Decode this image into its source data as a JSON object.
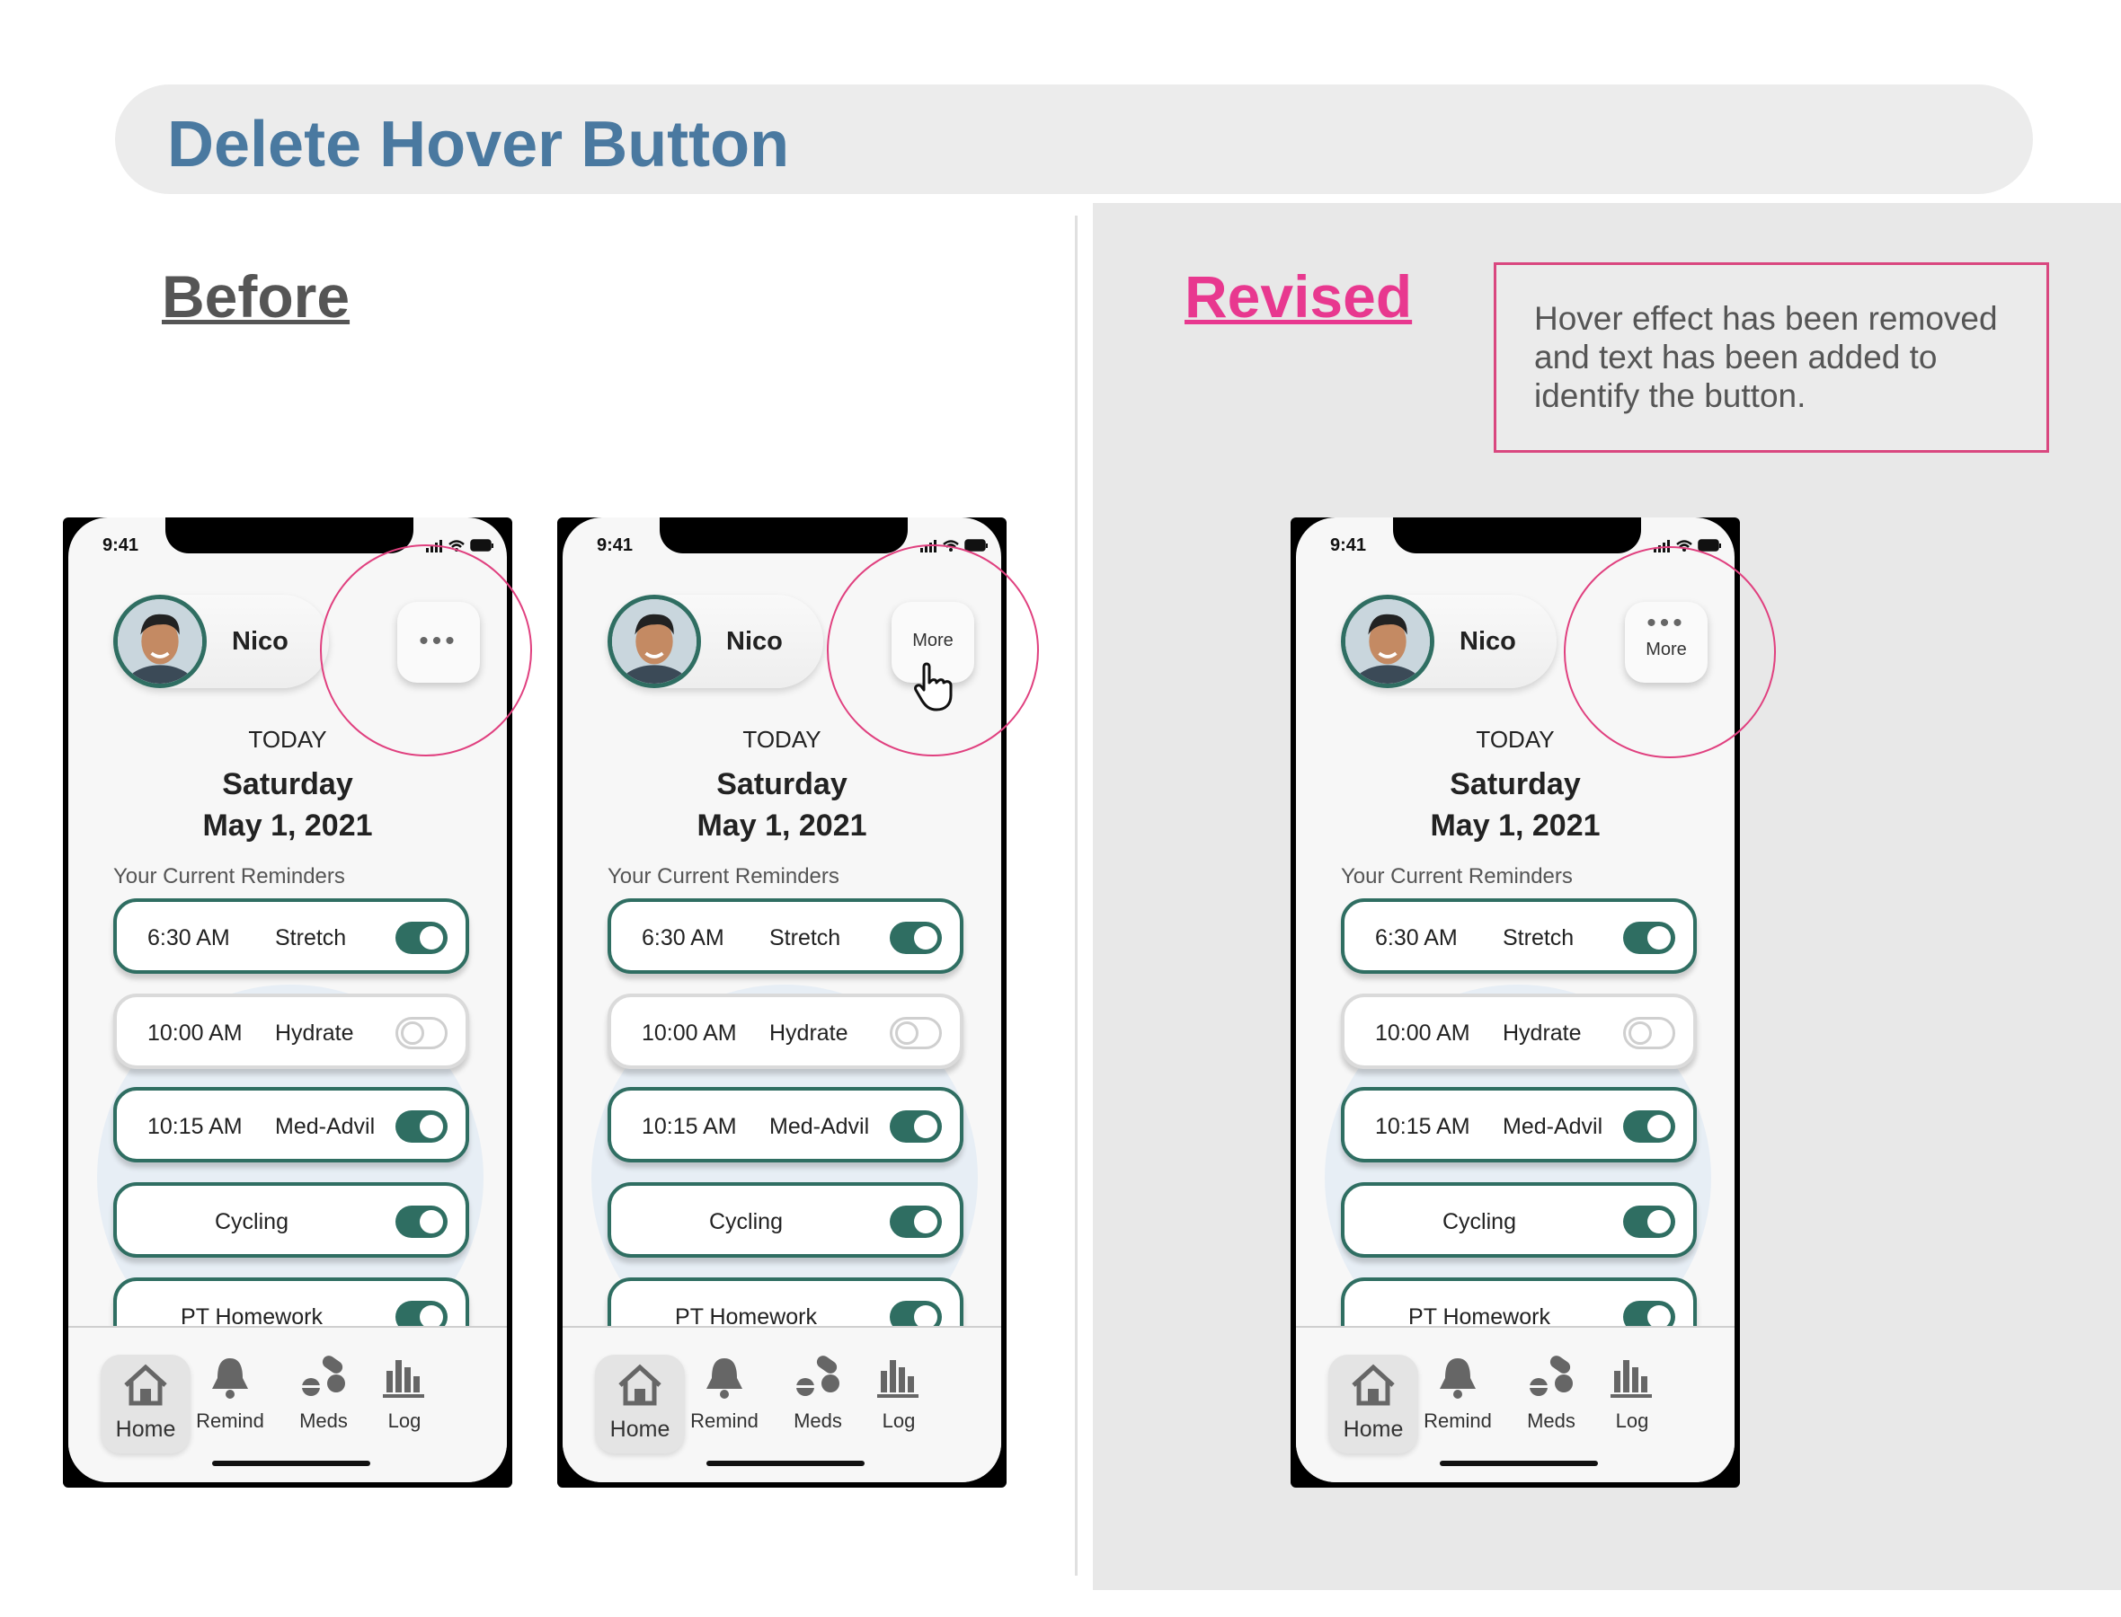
{
  "page": {
    "title": "Delete Hover Button",
    "before_heading": "Before",
    "revised_heading": "Revised",
    "note": "Hover effect has been removed and text has been added to identify the button."
  },
  "phones": [
    {
      "status_time": "9:41",
      "user_name": "Nico",
      "more_button": {
        "dots": "•••",
        "label": ""
      },
      "today_label": "TODAY",
      "weekday": "Saturday",
      "date": "May 1, 2021",
      "reminders_heading": "Your Current Reminders",
      "reminders": [
        {
          "time": "6:30 AM",
          "task": "Stretch",
          "enabled": true
        },
        {
          "time": "10:00 AM",
          "task": "Hydrate",
          "enabled": false
        },
        {
          "time": "10:15 AM",
          "task": "Med-Advil",
          "enabled": true
        },
        {
          "time": "",
          "task": "Cycling",
          "enabled": true
        },
        {
          "time": "",
          "task": "PT Homework",
          "enabled": true
        }
      ],
      "tabs": [
        "Home",
        "Remind",
        "Meds",
        "Log"
      ]
    },
    {
      "status_time": "9:41",
      "user_name": "Nico",
      "more_button": {
        "dots": "",
        "label": "More"
      },
      "today_label": "TODAY",
      "weekday": "Saturday",
      "date": "May 1, 2021",
      "reminders_heading": "Your Current Reminders",
      "reminders": [
        {
          "time": "6:30 AM",
          "task": "Stretch",
          "enabled": true
        },
        {
          "time": "10:00 AM",
          "task": "Hydrate",
          "enabled": false
        },
        {
          "time": "10:15 AM",
          "task": "Med-Advil",
          "enabled": true
        },
        {
          "time": "",
          "task": "Cycling",
          "enabled": true
        },
        {
          "time": "",
          "task": "PT Homework",
          "enabled": true
        }
      ],
      "tabs": [
        "Home",
        "Remind",
        "Meds",
        "Log"
      ]
    },
    {
      "status_time": "9:41",
      "user_name": "Nico",
      "more_button": {
        "dots": "•••",
        "label": "More"
      },
      "today_label": "TODAY",
      "weekday": "Saturday",
      "date": "May 1, 2021",
      "reminders_heading": "Your Current Reminders",
      "reminders": [
        {
          "time": "6:30 AM",
          "task": "Stretch",
          "enabled": true
        },
        {
          "time": "10:00 AM",
          "task": "Hydrate",
          "enabled": false
        },
        {
          "time": "10:15 AM",
          "task": "Med-Advil",
          "enabled": true
        },
        {
          "time": "",
          "task": "Cycling",
          "enabled": true
        },
        {
          "time": "",
          "task": "PT Homework",
          "enabled": true
        }
      ],
      "tabs": [
        "Home",
        "Remind",
        "Meds",
        "Log"
      ]
    }
  ],
  "colors": {
    "title_blue": "#4a79a0",
    "revised_pink": "#e8388f",
    "toggle_green": "#2f6e62",
    "ring_pink": "#e0407f"
  }
}
